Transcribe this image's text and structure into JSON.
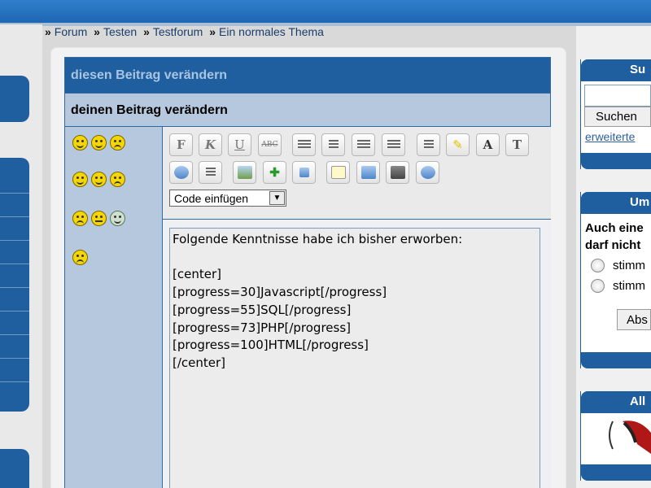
{
  "breadcrumb": {
    "sep": "»",
    "items": [
      "Forum",
      "Testen",
      "Testforum",
      "Ein normales Thema"
    ]
  },
  "form": {
    "header": "diesen Beitrag verändern",
    "subheader": "deinen Beitrag verändern",
    "code_select": "Code einfügen",
    "message": "Folgende Kenntnisse habe ich bisher erworben:\n\n[center]\n[progress=30]Javascript[/progress]\n[progress=55]SQL[/progress]\n[progress=73]PHP[/progress]\n[progress=100]HTML[/progress]\n[/center]"
  },
  "toolbar": {
    "bold": "F",
    "italic": "K",
    "underline": "U",
    "strike": "ABC",
    "font": "T",
    "icons": [
      "bold-icon",
      "italic-icon",
      "underline-icon",
      "strikethrough-icon",
      "align-left-icon",
      "align-center-icon",
      "align-right-icon",
      "justify-icon",
      "list-icon",
      "highlight-icon",
      "font-color-icon",
      "font-size-icon",
      "link-icon",
      "email-icon",
      "image-icon",
      "add-image-icon",
      "attachment-icon",
      "quote-icon",
      "copy-icon",
      "video-icon",
      "clock-icon"
    ]
  },
  "sidebar": {
    "search_title": "Su",
    "search_button": "Suchen",
    "advanced_link": "erweiterte",
    "poll_title": "Um",
    "poll_question_line1": "Auch eine",
    "poll_question_line2": "darf nicht",
    "poll_option1": "stimm",
    "poll_option2": "stimm",
    "vote_button": "Abs",
    "third_title": "All"
  },
  "colors": {
    "accent": "#1f5f9f",
    "light_panel": "#b6c8dd",
    "topbar": "#2f7fcc"
  }
}
